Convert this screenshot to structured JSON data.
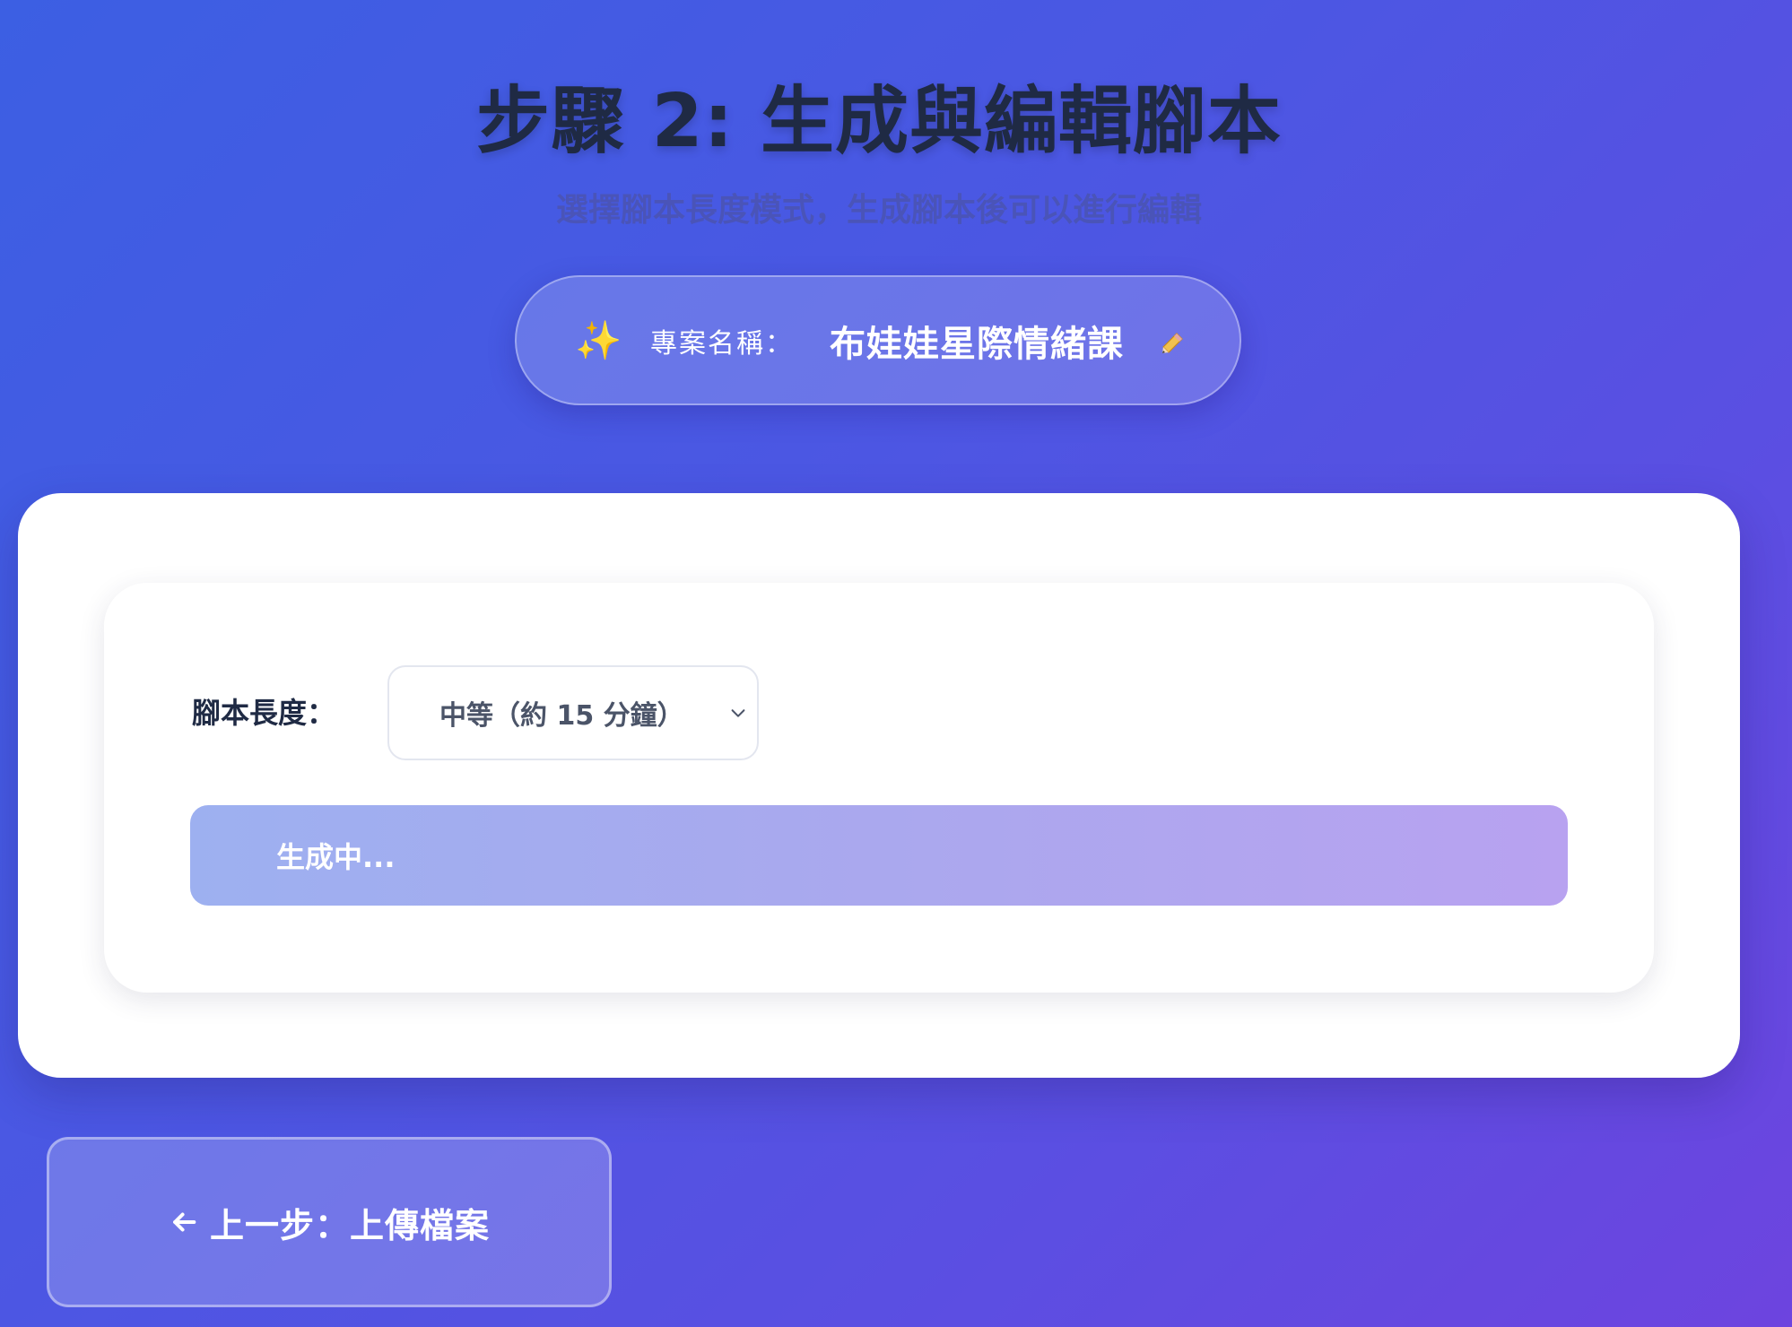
{
  "header": {
    "title": "步驟 2: 生成與編輯腳本",
    "subtitle": "選擇腳本長度模式，生成腳本後可以進行編輯"
  },
  "project": {
    "label": "專案名稱：",
    "name": "布娃娃星際情緒課",
    "sparkle_icon": "sparkle-icon",
    "edit_icon": "pencil-icon"
  },
  "script_settings": {
    "length_label": "腳本長度：",
    "length_selected": "中等（約 15 分鐘）"
  },
  "generate_button": {
    "label": "生成中..."
  },
  "navigation": {
    "back_label": "上一步：上傳檔案",
    "back_icon": "arrow-left-icon"
  },
  "colors": {
    "background_start": "#3c5fe3",
    "background_end": "#6d44df",
    "title": "#1f2a44",
    "button_gradient_start": "#9db0f0",
    "button_gradient_end": "#b8a2f0"
  }
}
